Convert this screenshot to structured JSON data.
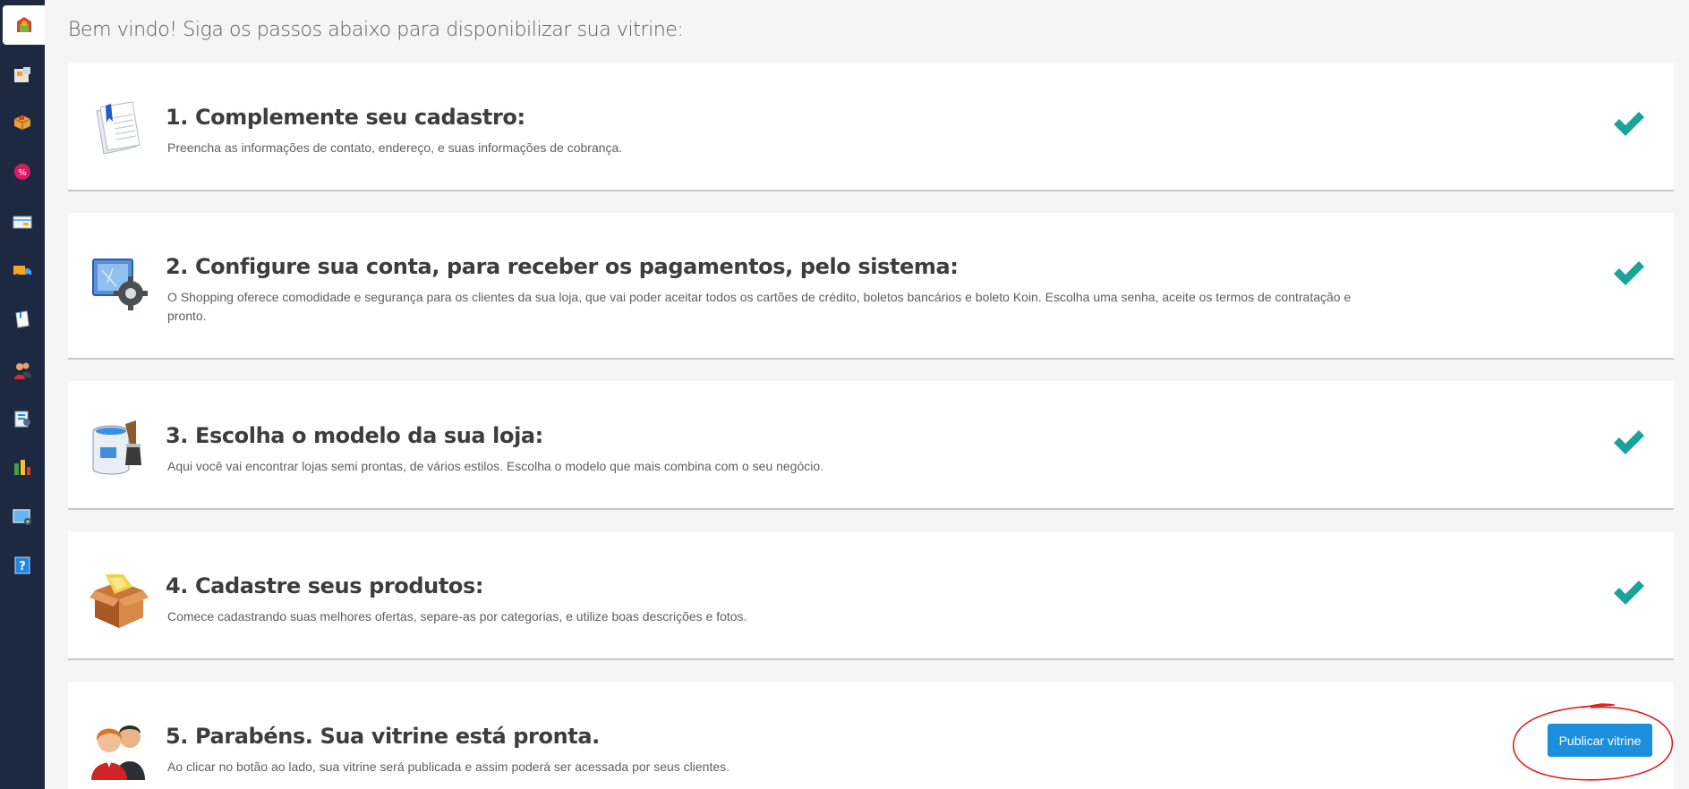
{
  "sidebar": {
    "items": [
      {
        "icon": "store-home-icon"
      },
      {
        "icon": "catalog-icon"
      },
      {
        "icon": "products-box-icon"
      },
      {
        "icon": "discount-icon"
      },
      {
        "icon": "payment-card-icon"
      },
      {
        "icon": "shipping-truck-icon"
      },
      {
        "icon": "documents-icon"
      },
      {
        "icon": "customers-icon"
      },
      {
        "icon": "orders-icon"
      },
      {
        "icon": "reports-chart-icon"
      },
      {
        "icon": "layout-settings-icon"
      },
      {
        "icon": "help-icon"
      }
    ]
  },
  "welcome": "Bem vindo! Siga os passos abaixo para disponibilizar sua vitrine:",
  "steps": [
    {
      "title": "1. Complemente seu cadastro:",
      "description": "Preencha as informações de contato, endereço, e suas informações de cobrança.",
      "done": true
    },
    {
      "title": "2. Configure sua conta, para receber os pagamentos, pelo sistema:",
      "description": "O Shopping oferece comodidade e segurança para os clientes da sua loja, que vai poder aceitar todos os cartões de crédito, boletos bancários e boleto Koin. Escolha uma senha, aceite os termos de contratação e pronto.",
      "done": true
    },
    {
      "title": "3. Escolha o modelo da sua loja:",
      "description": "Aqui você vai encontrar lojas semi prontas, de vários estilos. Escolha o modelo que mais combina com o seu negócio.",
      "done": true
    },
    {
      "title": "4. Cadastre seus produtos:",
      "description": "Comece cadastrando suas melhores ofertas, separe-as por categorias, e utilize boas descrições e fotos.",
      "done": true
    },
    {
      "title": "5. Parabéns. Sua vitrine está pronta.",
      "description": "Ao clicar no botão ao lado, sua vitrine será publicada e assim poderá ser acessada por seus clientes.",
      "done": false
    }
  ],
  "publish_button": "Publicar vitrine",
  "colors": {
    "sidebar_bg": "#1d2940",
    "check": "#1aa39a",
    "button": "#1b8fdc",
    "annotation": "#e0201e"
  }
}
